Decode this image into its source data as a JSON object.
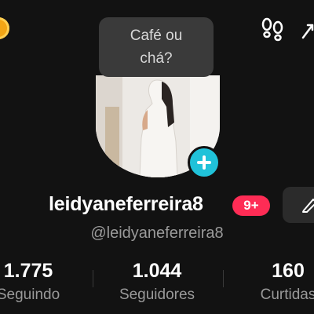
{
  "status_bubble": {
    "text": "Café ou chá?"
  },
  "profile": {
    "username": "leidyaneferreira8",
    "notification_badge": "9+",
    "handle": "@leidyaneferreira8"
  },
  "stats": [
    {
      "value": "1.775",
      "label": "Seguindo"
    },
    {
      "value": "1.044",
      "label": "Seguidores"
    },
    {
      "value": "160",
      "label": "Curtidas"
    }
  ],
  "icons": {
    "top_left": "coin-icon",
    "top_right": [
      "footprints-icon",
      "share-icon"
    ],
    "avatar_add": "plus-icon",
    "edit": "pencil-icon"
  },
  "colors": {
    "background": "#121212",
    "accent_badge": "#fe2c55",
    "add_button": "#20c2d9",
    "coin": "#f2a515"
  }
}
